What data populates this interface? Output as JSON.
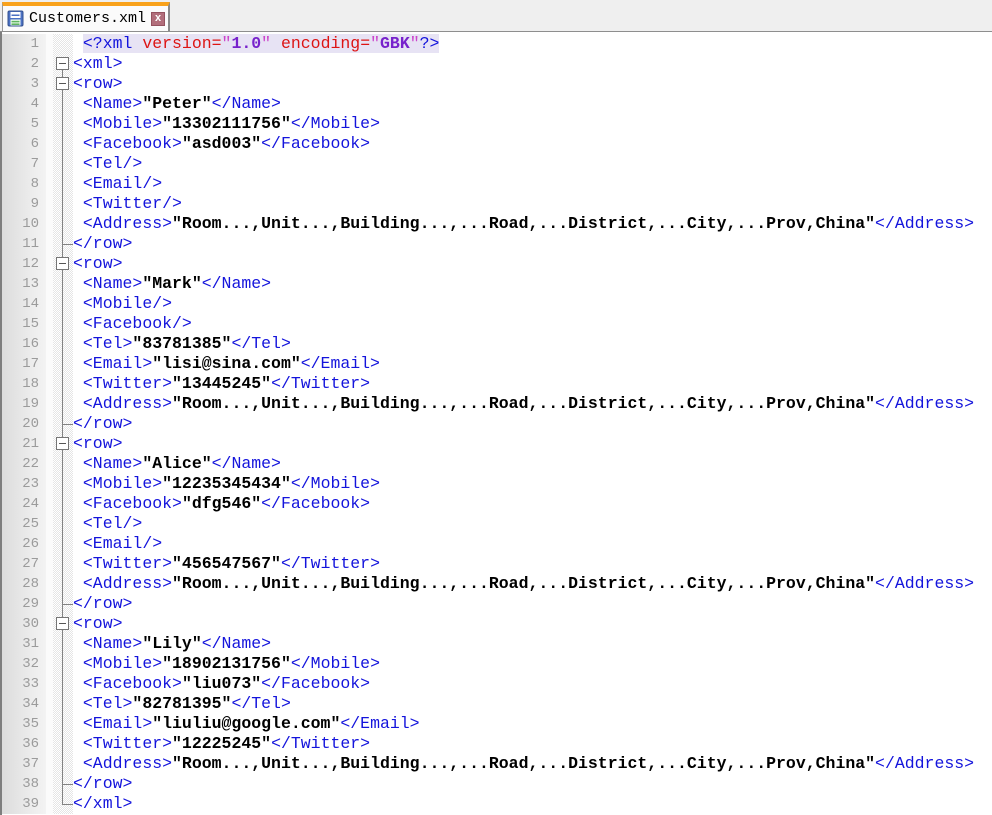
{
  "colors": {
    "tag_blue": "#1414DC",
    "attr_red": "#DD1414",
    "quote_magenta": "#CC44CC",
    "value_purple": "#7722CC",
    "content_black": "#000000",
    "decl_background": "#E7E3F4",
    "tab_accent_orange": "#F9A21B",
    "close_button_maroon": "#B26E7B"
  },
  "tab": {
    "title": "Customers.xml",
    "icon": "save-floppy-icon",
    "close_label": "x"
  },
  "editor": {
    "lines": [
      {
        "n": 1,
        "indent": 1,
        "fold": "",
        "decl": true,
        "segs": [
          [
            "t",
            "<?xml"
          ],
          [
            "a",
            " version="
          ],
          [
            "q",
            "\""
          ],
          [
            "v",
            "1.0"
          ],
          [
            "q",
            "\""
          ],
          [
            "a",
            " encoding="
          ],
          [
            "q",
            "\""
          ],
          [
            "v",
            "GBK"
          ],
          [
            "q",
            "\""
          ],
          [
            "t",
            "?>"
          ]
        ]
      },
      {
        "n": 2,
        "indent": 0,
        "fold": "box-first",
        "segs": [
          [
            "t",
            "<xml>"
          ]
        ]
      },
      {
        "n": 3,
        "indent": 0,
        "fold": "box",
        "segs": [
          [
            "t",
            "<row>"
          ]
        ]
      },
      {
        "n": 4,
        "indent": 1,
        "fold": "v",
        "segs": [
          [
            "t",
            "<Name>"
          ],
          [
            "c",
            "\"Peter\""
          ],
          [
            "t",
            "</Name>"
          ]
        ]
      },
      {
        "n": 5,
        "indent": 1,
        "fold": "v",
        "segs": [
          [
            "t",
            "<Mobile>"
          ],
          [
            "c",
            "\"13302111756\""
          ],
          [
            "t",
            "</Mobile>"
          ]
        ]
      },
      {
        "n": 6,
        "indent": 1,
        "fold": "v",
        "segs": [
          [
            "t",
            "<Facebook>"
          ],
          [
            "c",
            "\"asd003\""
          ],
          [
            "t",
            "</Facebook>"
          ]
        ]
      },
      {
        "n": 7,
        "indent": 1,
        "fold": "v",
        "segs": [
          [
            "t",
            "<Tel/>"
          ]
        ]
      },
      {
        "n": 8,
        "indent": 1,
        "fold": "v",
        "segs": [
          [
            "t",
            "<Email/>"
          ]
        ]
      },
      {
        "n": 9,
        "indent": 1,
        "fold": "v",
        "segs": [
          [
            "t",
            "<Twitter/>"
          ]
        ]
      },
      {
        "n": 10,
        "indent": 1,
        "fold": "v",
        "segs": [
          [
            "t",
            "<Address>"
          ],
          [
            "c",
            "\"Room...,Unit...,Building...,...Road,...District,...City,...Prov,China\""
          ],
          [
            "t",
            "</Address>"
          ]
        ]
      },
      {
        "n": 11,
        "indent": 0,
        "fold": "t",
        "segs": [
          [
            "t",
            "</row>"
          ]
        ]
      },
      {
        "n": 12,
        "indent": 0,
        "fold": "box",
        "segs": [
          [
            "t",
            "<row>"
          ]
        ]
      },
      {
        "n": 13,
        "indent": 1,
        "fold": "v",
        "segs": [
          [
            "t",
            "<Name>"
          ],
          [
            "c",
            "\"Mark\""
          ],
          [
            "t",
            "</Name>"
          ]
        ]
      },
      {
        "n": 14,
        "indent": 1,
        "fold": "v",
        "segs": [
          [
            "t",
            "<Mobile/>"
          ]
        ]
      },
      {
        "n": 15,
        "indent": 1,
        "fold": "v",
        "segs": [
          [
            "t",
            "<Facebook/>"
          ]
        ]
      },
      {
        "n": 16,
        "indent": 1,
        "fold": "v",
        "segs": [
          [
            "t",
            "<Tel>"
          ],
          [
            "c",
            "\"83781385\""
          ],
          [
            "t",
            "</Tel>"
          ]
        ]
      },
      {
        "n": 17,
        "indent": 1,
        "fold": "v",
        "segs": [
          [
            "t",
            "<Email>"
          ],
          [
            "c",
            "\"lisi@sina.com\""
          ],
          [
            "t",
            "</Email>"
          ]
        ]
      },
      {
        "n": 18,
        "indent": 1,
        "fold": "v",
        "segs": [
          [
            "t",
            "<Twitter>"
          ],
          [
            "c",
            "\"13445245\""
          ],
          [
            "t",
            "</Twitter>"
          ]
        ]
      },
      {
        "n": 19,
        "indent": 1,
        "fold": "v",
        "segs": [
          [
            "t",
            "<Address>"
          ],
          [
            "c",
            "\"Room...,Unit...,Building...,...Road,...District,...City,...Prov,China\""
          ],
          [
            "t",
            "</Address>"
          ]
        ]
      },
      {
        "n": 20,
        "indent": 0,
        "fold": "t",
        "segs": [
          [
            "t",
            "</row>"
          ]
        ]
      },
      {
        "n": 21,
        "indent": 0,
        "fold": "box",
        "segs": [
          [
            "t",
            "<row>"
          ]
        ]
      },
      {
        "n": 22,
        "indent": 1,
        "fold": "v",
        "segs": [
          [
            "t",
            "<Name>"
          ],
          [
            "c",
            "\"Alice\""
          ],
          [
            "t",
            "</Name>"
          ]
        ]
      },
      {
        "n": 23,
        "indent": 1,
        "fold": "v",
        "segs": [
          [
            "t",
            "<Mobile>"
          ],
          [
            "c",
            "\"12235345434\""
          ],
          [
            "t",
            "</Mobile>"
          ]
        ]
      },
      {
        "n": 24,
        "indent": 1,
        "fold": "v",
        "segs": [
          [
            "t",
            "<Facebook>"
          ],
          [
            "c",
            "\"dfg546\""
          ],
          [
            "t",
            "</Facebook>"
          ]
        ]
      },
      {
        "n": 25,
        "indent": 1,
        "fold": "v",
        "segs": [
          [
            "t",
            "<Tel/>"
          ]
        ]
      },
      {
        "n": 26,
        "indent": 1,
        "fold": "v",
        "segs": [
          [
            "t",
            "<Email/>"
          ]
        ]
      },
      {
        "n": 27,
        "indent": 1,
        "fold": "v",
        "segs": [
          [
            "t",
            "<Twitter>"
          ],
          [
            "c",
            "\"456547567\""
          ],
          [
            "t",
            "</Twitter>"
          ]
        ]
      },
      {
        "n": 28,
        "indent": 1,
        "fold": "v",
        "segs": [
          [
            "t",
            "<Address>"
          ],
          [
            "c",
            "\"Room...,Unit...,Building...,...Road,...District,...City,...Prov,China\""
          ],
          [
            "t",
            "</Address>"
          ]
        ]
      },
      {
        "n": 29,
        "indent": 0,
        "fold": "t",
        "segs": [
          [
            "t",
            "</row>"
          ]
        ]
      },
      {
        "n": 30,
        "indent": 0,
        "fold": "box",
        "segs": [
          [
            "t",
            "<row>"
          ]
        ]
      },
      {
        "n": 31,
        "indent": 1,
        "fold": "v",
        "segs": [
          [
            "t",
            "<Name>"
          ],
          [
            "c",
            "\"Lily\""
          ],
          [
            "t",
            "</Name>"
          ]
        ]
      },
      {
        "n": 32,
        "indent": 1,
        "fold": "v",
        "segs": [
          [
            "t",
            "<Mobile>"
          ],
          [
            "c",
            "\"18902131756\""
          ],
          [
            "t",
            "</Mobile>"
          ]
        ]
      },
      {
        "n": 33,
        "indent": 1,
        "fold": "v",
        "segs": [
          [
            "t",
            "<Facebook>"
          ],
          [
            "c",
            "\"liu073\""
          ],
          [
            "t",
            "</Facebook>"
          ]
        ]
      },
      {
        "n": 34,
        "indent": 1,
        "fold": "v",
        "segs": [
          [
            "t",
            "<Tel>"
          ],
          [
            "c",
            "\"82781395\""
          ],
          [
            "t",
            "</Tel>"
          ]
        ]
      },
      {
        "n": 35,
        "indent": 1,
        "fold": "v",
        "segs": [
          [
            "t",
            "<Email>"
          ],
          [
            "c",
            "\"liuliu@google.com\""
          ],
          [
            "t",
            "</Email>"
          ]
        ]
      },
      {
        "n": 36,
        "indent": 1,
        "fold": "v",
        "segs": [
          [
            "t",
            "<Twitter>"
          ],
          [
            "c",
            "\"12225245\""
          ],
          [
            "t",
            "</Twitter>"
          ]
        ]
      },
      {
        "n": 37,
        "indent": 1,
        "fold": "v",
        "segs": [
          [
            "t",
            "<Address>"
          ],
          [
            "c",
            "\"Room...,Unit...,Building...,...Road,...District,...City,...Prov,China\""
          ],
          [
            "t",
            "</Address>"
          ]
        ]
      },
      {
        "n": 38,
        "indent": 0,
        "fold": "t",
        "segs": [
          [
            "t",
            "</row>"
          ]
        ]
      },
      {
        "n": 39,
        "indent": 0,
        "fold": "l",
        "segs": [
          [
            "t",
            "</xml>"
          ]
        ]
      }
    ]
  }
}
